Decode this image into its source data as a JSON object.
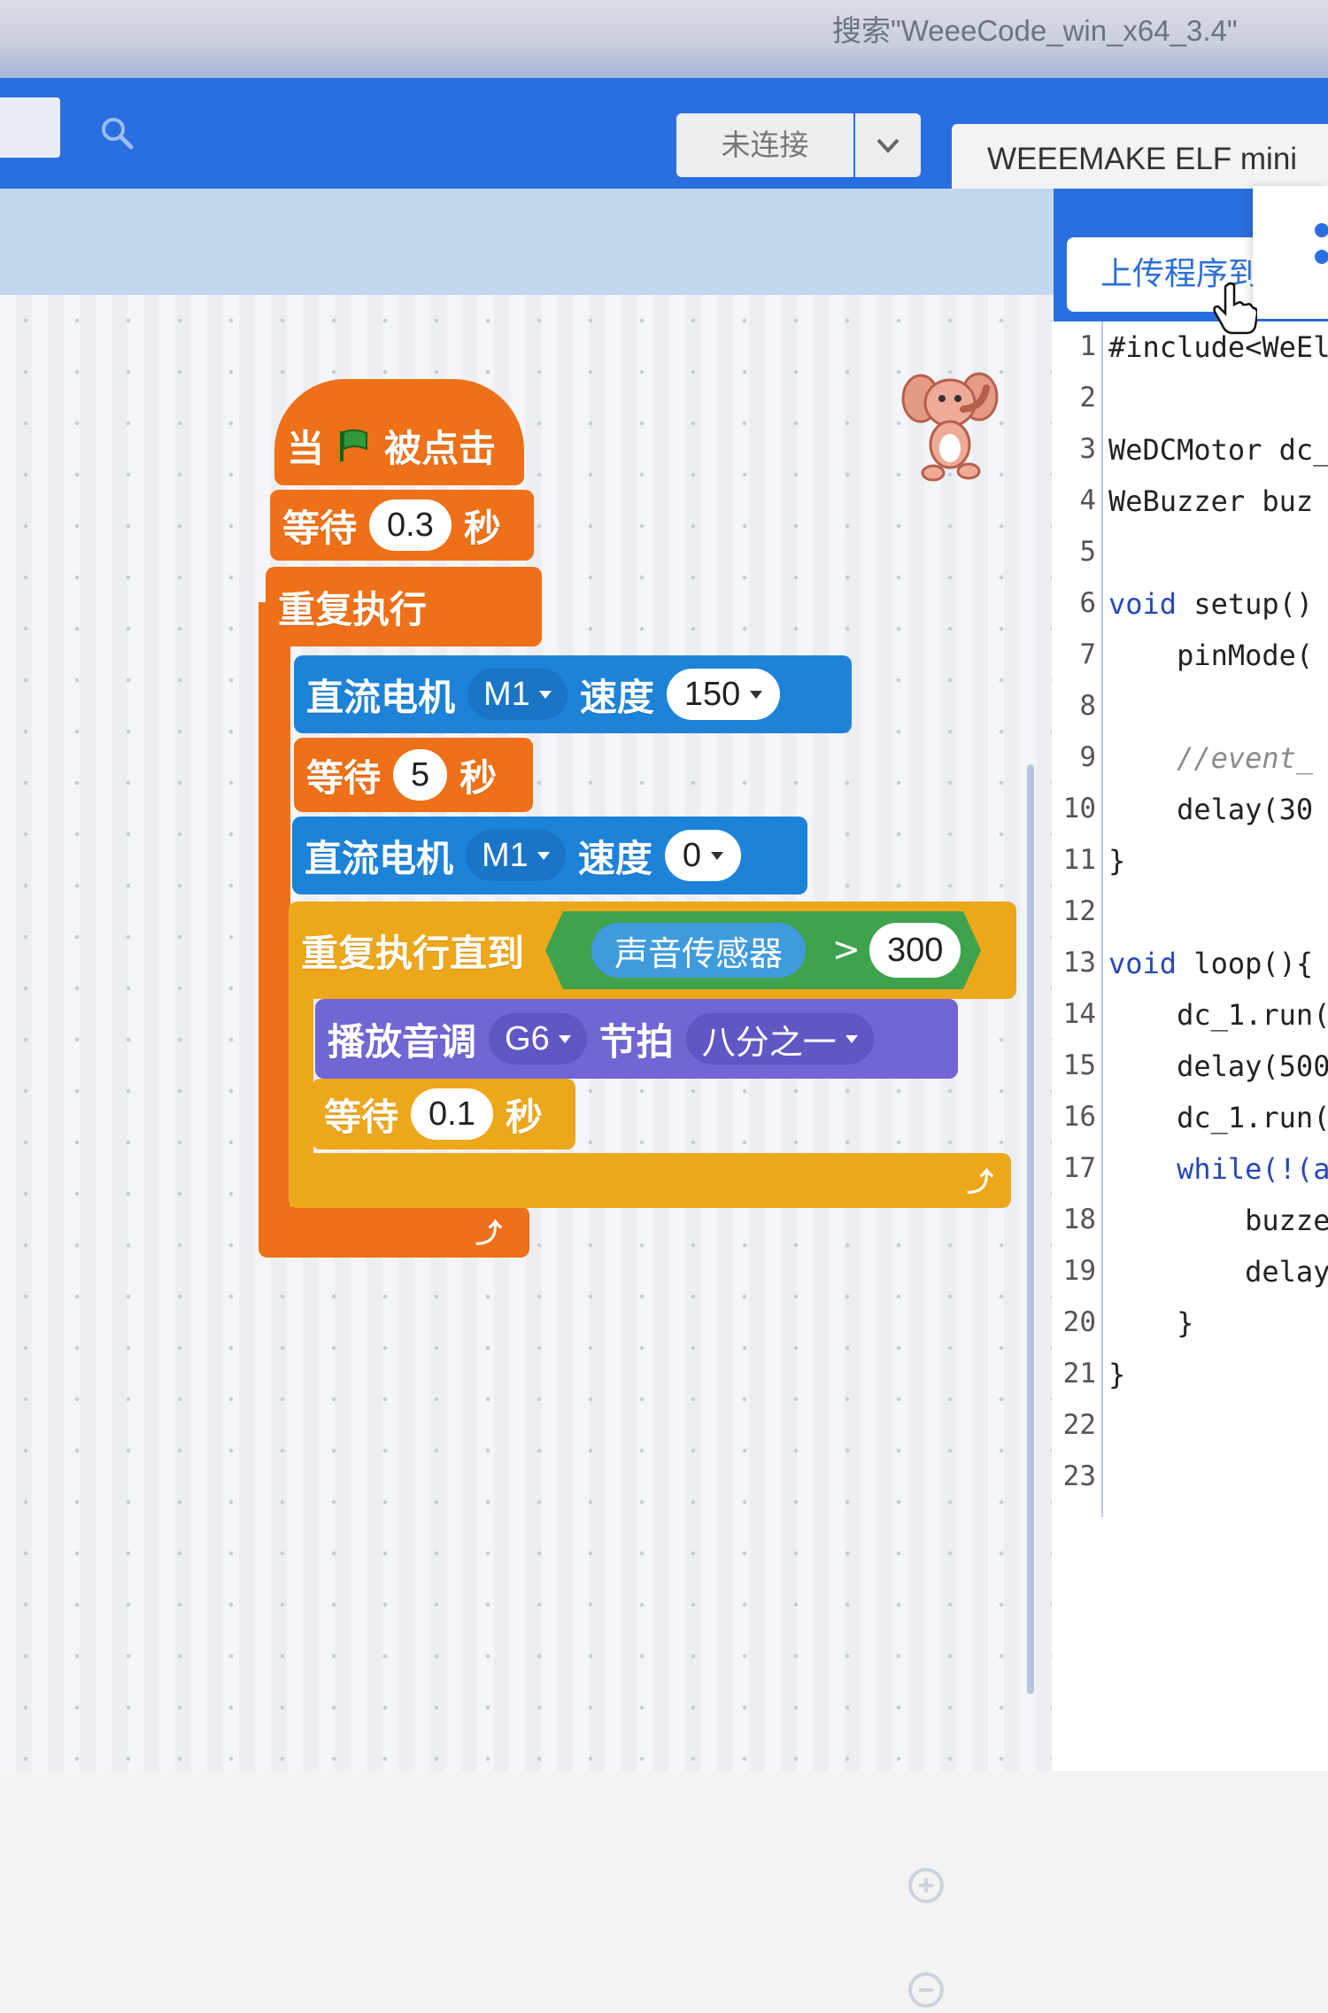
{
  "window": {
    "title": "搜索\"WeeeCode_win_x64_3.4\""
  },
  "toolbar": {
    "connection_status": "未连接",
    "device": "WEEEMAKE ELF mini",
    "upload_label": "上传程序到"
  },
  "blocks": {
    "hat_when": "当",
    "hat_clicked": "被点击",
    "wait1": {
      "label": "等待",
      "value": "0.3",
      "unit": "秒"
    },
    "forever": "重复执行",
    "motor1": {
      "label": "直流电机",
      "port": "M1",
      "speed_label": "速度",
      "speed": "150"
    },
    "wait2": {
      "label": "等待",
      "value": "5",
      "unit": "秒"
    },
    "motor2": {
      "label": "直流电机",
      "port": "M1",
      "speed_label": "速度",
      "speed": "0"
    },
    "repeat_until": {
      "label": "重复执行直到",
      "sensor": "声音传感器",
      "op": ">",
      "value": "300"
    },
    "play_tone": {
      "label": "播放音调",
      "note": "G6",
      "beat_label": "节拍",
      "beat": "八分之一"
    },
    "wait3": {
      "label": "等待",
      "value": "0.1",
      "unit": "秒"
    }
  },
  "code": {
    "line_numbers": [
      "1",
      "2",
      "3",
      "4",
      "5",
      "6",
      "7",
      "8",
      "9",
      "10",
      "11",
      "12",
      "13",
      "14",
      "15",
      "16",
      "17",
      "18",
      "19",
      "20",
      "21",
      "22",
      "23"
    ],
    "l1": "#include<WeEl",
    "l3": "WeDCMotor dc_",
    "l4": "WeBuzzer buz",
    "l6_kw": "void",
    "l6": " setup()",
    "l7": "    pinMode(",
    "l9": "    //event_",
    "l10": "    delay(30",
    "l11": "}",
    "l13_kw": "void",
    "l13": " loop(){",
    "l14": "    dc_1.run(",
    "l15": "    delay(500",
    "l16": "    dc_1.run(",
    "l17": "    while(!(a",
    "l18": "        buzze",
    "l19": "        delay",
    "l20": "    }",
    "l21": "}"
  },
  "colors": {
    "toolbar": "#2a6fe0",
    "events": "#ee7018",
    "control": "#eda71b",
    "motor": "#1c83d8",
    "sound": "#7066d4",
    "sensor": "#3fa34d"
  }
}
